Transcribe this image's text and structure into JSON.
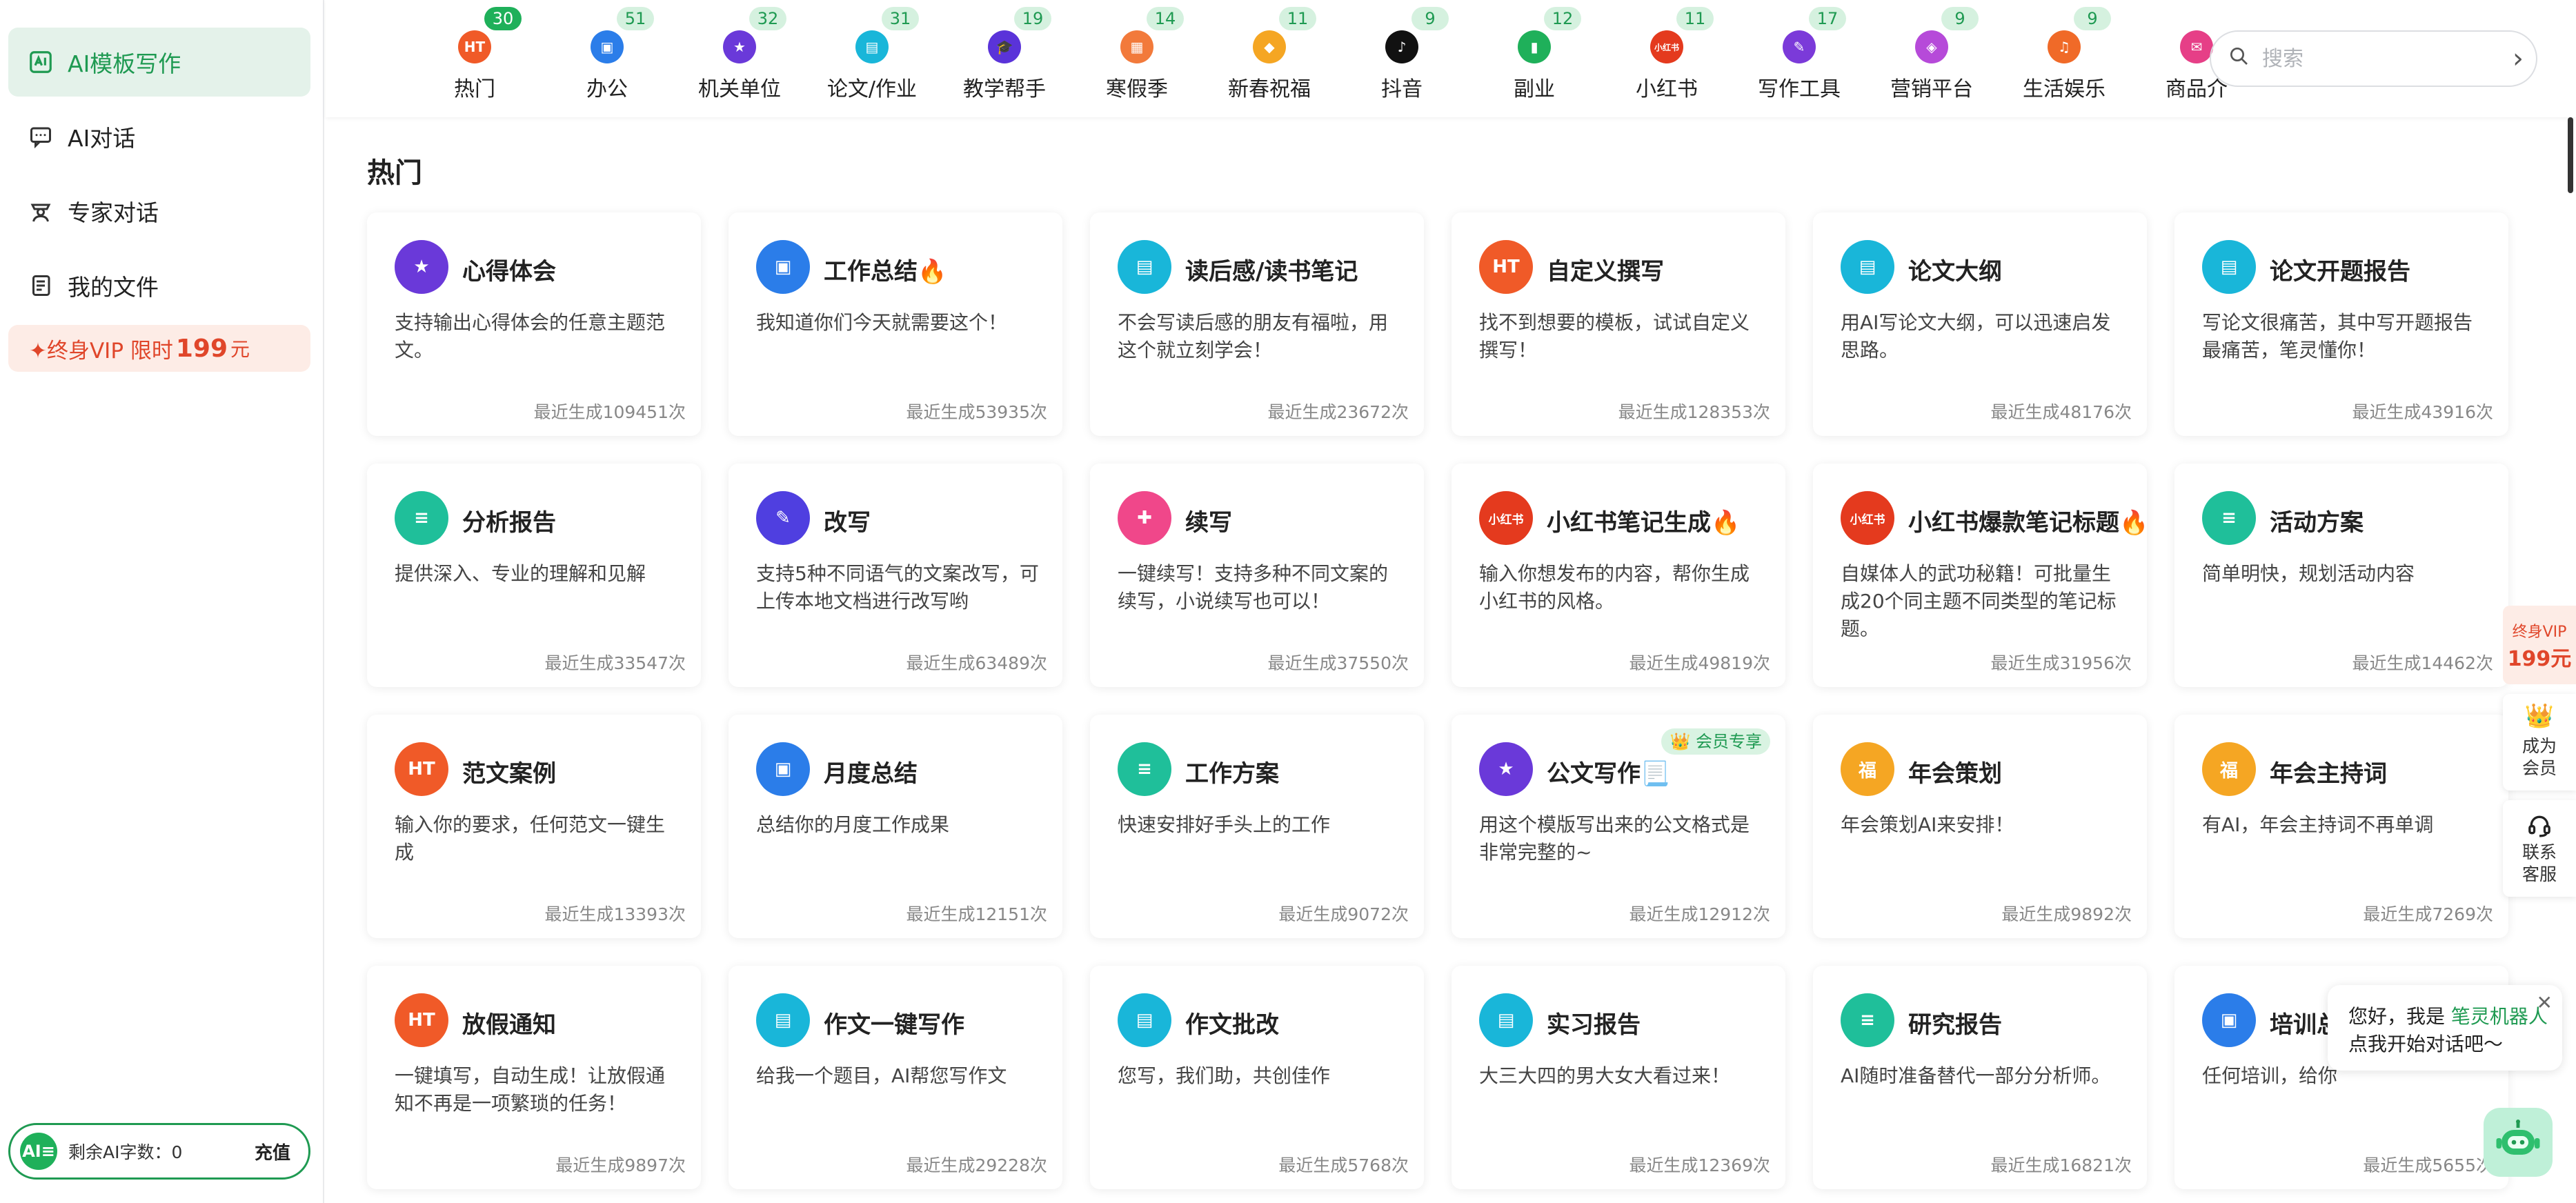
{
  "sidebar": {
    "items": [
      {
        "label": "AI模板写作",
        "icon": "ai-template-icon"
      },
      {
        "label": "AI对话",
        "icon": "chat-icon"
      },
      {
        "label": "专家对话",
        "icon": "expert-icon"
      },
      {
        "label": "我的文件",
        "icon": "file-icon"
      }
    ],
    "vip": {
      "prefix": "✦终身VIP 限时",
      "price": "199",
      "unit": "元"
    },
    "words": {
      "avatar": "AI≡",
      "label": "剩余AI字数：0",
      "recharge": "充值"
    }
  },
  "categories": [
    {
      "label": "热门",
      "count": "30",
      "color": "#f05a28",
      "glyph": "HT"
    },
    {
      "label": "办公",
      "count": "51",
      "color": "#2b7de9",
      "glyph": "▣"
    },
    {
      "label": "机关单位",
      "count": "32",
      "color": "#6a39d9",
      "glyph": "★"
    },
    {
      "label": "论文/作业",
      "count": "31",
      "color": "#19b6d9",
      "glyph": "▤"
    },
    {
      "label": "教学帮手",
      "count": "19",
      "color": "#5a33d9",
      "glyph": "🎓"
    },
    {
      "label": "寒假季",
      "count": "14",
      "color": "#f27a3b",
      "glyph": "▦"
    },
    {
      "label": "新春祝福",
      "count": "11",
      "color": "#f5a623",
      "glyph": "◆"
    },
    {
      "label": "抖音",
      "count": "9",
      "color": "#111111",
      "glyph": "♪"
    },
    {
      "label": "副业",
      "count": "12",
      "color": "#1fb05a",
      "glyph": "▮"
    },
    {
      "label": "小红书",
      "count": "11",
      "color": "#e43a1e",
      "glyph": "小红书"
    },
    {
      "label": "写作工具",
      "count": "17",
      "color": "#7b3ad9",
      "glyph": "✎"
    },
    {
      "label": "营销平台",
      "count": "9",
      "color": "#b64ad9",
      "glyph": "◈"
    },
    {
      "label": "生活娱乐",
      "count": "9",
      "color": "#f06a28",
      "glyph": "♫"
    },
    {
      "label": "商品介",
      "count": "",
      "color": "#e63f87",
      "glyph": "✉"
    }
  ],
  "search": {
    "placeholder": "搜索"
  },
  "section_title": "热门",
  "cards": [
    {
      "title": "心得体会",
      "desc": "支持输出心得体会的任意主题范文。",
      "count": "最近生成109451次",
      "color": "#6a39d9",
      "icon": "star-badge-icon",
      "glyph": "★"
    },
    {
      "title": "工作总结🔥",
      "desc": "我知道你们今天就需要这个！",
      "count": "最近生成53935次",
      "color": "#2b7de9",
      "icon": "briefcase-icon",
      "glyph": "▣"
    },
    {
      "title": "读后感/读书笔记",
      "desc": "不会写读后感的朋友有福啦，用这个就立刻学会！",
      "count": "最近生成23672次",
      "color": "#19b6d9",
      "icon": "book-icon",
      "glyph": "▤"
    },
    {
      "title": "自定义撰写",
      "desc": "找不到想要的模板，试试自定义撰写！",
      "count": "最近生成128353次",
      "color": "#f05a28",
      "icon": "hot-flame-icon",
      "glyph": "HT"
    },
    {
      "title": "论文大纲",
      "desc": "用AI写论文大纲，可以迅速启发思路。",
      "count": "最近生成48176次",
      "color": "#19b6d9",
      "icon": "book-icon",
      "glyph": "▤"
    },
    {
      "title": "论文开题报告",
      "desc": "写论文很痛苦，其中写开题报告最痛苦，笔灵懂你！",
      "count": "最近生成43916次",
      "color": "#19b6d9",
      "icon": "book-icon",
      "glyph": "▤"
    },
    {
      "title": "分析报告",
      "desc": "提供深入、专业的理解和见解",
      "count": "最近生成33547次",
      "color": "#1fbf9a",
      "icon": "document-icon",
      "glyph": "≡"
    },
    {
      "title": "改写",
      "desc": "支持5种不同语气的文案改写，可上传本地文档进行改写哟",
      "count": "最近生成63489次",
      "color": "#4f3fe0",
      "icon": "feather-icon",
      "glyph": "✎"
    },
    {
      "title": "续写",
      "desc": "一键续写！支持多种不同文案的续写，小说续写也可以！",
      "count": "最近生成37550次",
      "color": "#f0478a",
      "icon": "edit-plus-icon",
      "glyph": "✚"
    },
    {
      "title": "小红书笔记生成🔥",
      "desc": "输入你想发布的内容，帮你生成小红书的风格。",
      "count": "最近生成49819次",
      "color": "#e43a1e",
      "icon": "xiaohongshu-icon",
      "glyph": "小红书"
    },
    {
      "title": "小红书爆款笔记标题🔥",
      "desc": "自媒体人的武功秘籍！可批量生成20个同主题不同类型的笔记标题。",
      "count": "最近生成31956次",
      "color": "#e43a1e",
      "icon": "xiaohongshu-icon",
      "glyph": "小红书"
    },
    {
      "title": "活动方案",
      "desc": "简单明快，规划活动内容",
      "count": "最近生成14462次",
      "color": "#1fbf9a",
      "icon": "document-icon",
      "glyph": "≡"
    },
    {
      "title": "范文案例",
      "desc": "输入你的要求，任何范文一键生成",
      "count": "最近生成13393次",
      "color": "#f05a28",
      "icon": "hot-flame-icon",
      "glyph": "HT"
    },
    {
      "title": "月度总结",
      "desc": "总结你的月度工作成果",
      "count": "最近生成12151次",
      "color": "#2b7de9",
      "icon": "briefcase-icon",
      "glyph": "▣"
    },
    {
      "title": "工作方案",
      "desc": "快速安排好手头上的工作",
      "count": "最近生成9072次",
      "color": "#1fbf9a",
      "icon": "document-icon",
      "glyph": "≡"
    },
    {
      "title": "公文写作📃",
      "desc": "用这个模版写出来的公文格式是非常完整的~",
      "count": "最近生成12912次",
      "color": "#6a39d9",
      "icon": "star-badge-icon",
      "glyph": "★",
      "badge": "👑 会员专享"
    },
    {
      "title": "年会策划",
      "desc": "年会策划AI来安排！",
      "count": "最近生成9892次",
      "color": "#f5a623",
      "icon": "lucky-icon",
      "glyph": "福"
    },
    {
      "title": "年会主持词",
      "desc": "有AI，年会主持词不再单调",
      "count": "最近生成7269次",
      "color": "#f5a623",
      "icon": "lucky-icon",
      "glyph": "福"
    },
    {
      "title": "放假通知",
      "desc": "一键填写，自动生成！让放假通知不再是一项繁琐的任务！",
      "count": "最近生成9897次",
      "color": "#f05a28",
      "icon": "hot-flame-icon",
      "glyph": "HT"
    },
    {
      "title": "作文一键写作",
      "desc": "给我一个题目，AI帮您写作文",
      "count": "最近生成29228次",
      "color": "#19b6d9",
      "icon": "book-icon",
      "glyph": "▤"
    },
    {
      "title": "作文批改",
      "desc": "您写，我们助，共创佳作",
      "count": "最近生成5768次",
      "color": "#19b6d9",
      "icon": "book-icon",
      "glyph": "▤"
    },
    {
      "title": "实习报告",
      "desc": "大三大四的男大女大看过来！",
      "count": "最近生成12369次",
      "color": "#19b6d9",
      "icon": "book-icon",
      "glyph": "▤"
    },
    {
      "title": "研究报告",
      "desc": "AI随时准备替代一部分分析师。",
      "count": "最近生成16821次",
      "color": "#1fbf9a",
      "icon": "document-icon",
      "glyph": "≡"
    },
    {
      "title": "培训总",
      "desc": "任何培训，给你",
      "count": "最近生成5655次",
      "color": "#2b7de9",
      "icon": "briefcase-icon",
      "glyph": "▣"
    }
  ],
  "float": {
    "vip_line1": "终身VIP",
    "vip_line2": "199元",
    "member_l1": "成为",
    "member_l2": "会员",
    "service_l1": "联系",
    "service_l2": "客服"
  },
  "bubble": {
    "line1_a": "您好，我是 ",
    "line1_b": "笔灵机器人",
    "line2": "点我开始对话吧～",
    "close": "✕"
  },
  "colors": {
    "accent": "#1fb05a",
    "vip": "#e0462a"
  }
}
